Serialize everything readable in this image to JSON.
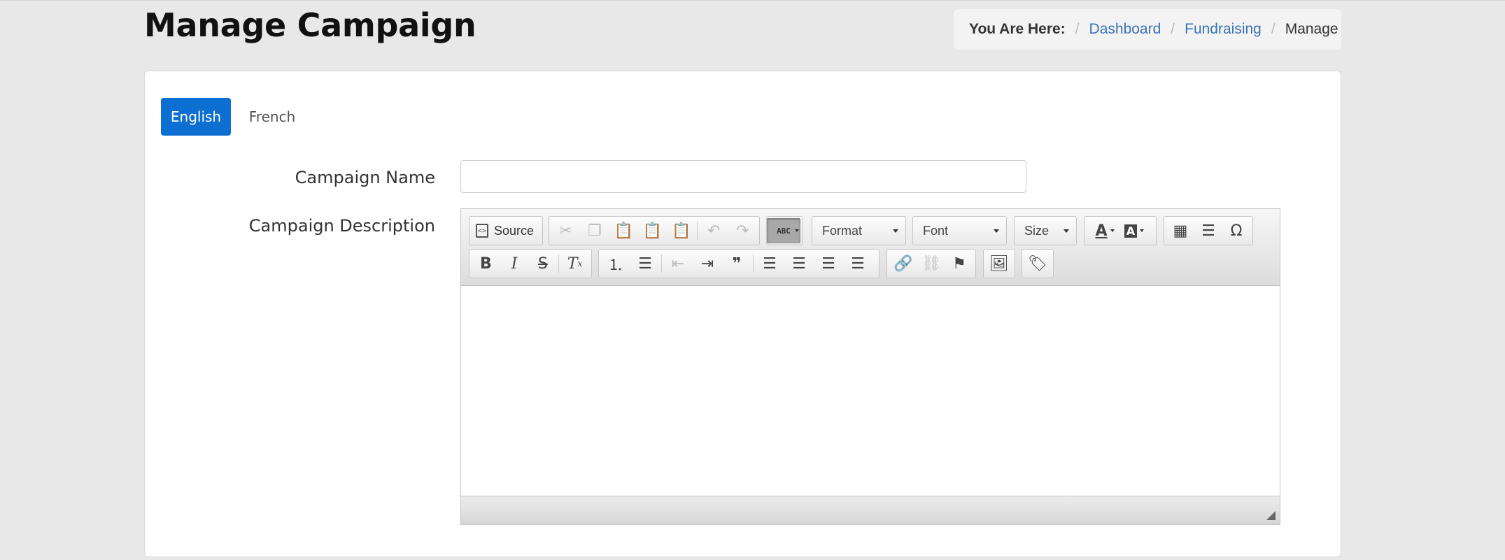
{
  "page": {
    "title": "Manage Campaign"
  },
  "breadcrumb": {
    "label": "You Are Here:",
    "items": [
      {
        "text": "Dashboard"
      },
      {
        "text": "Fundraising"
      },
      {
        "text": "Manage"
      }
    ]
  },
  "tabs": [
    {
      "label": "English",
      "active": true
    },
    {
      "label": "French",
      "active": false
    }
  ],
  "form": {
    "campaign_name_label": "Campaign Name",
    "campaign_name_value": "",
    "campaign_description_label": "Campaign Description"
  },
  "editor": {
    "source_label": "Source",
    "format_label": "Format",
    "font_label": "Font",
    "size_label": "Size",
    "spellcheck_label": "ABC",
    "content": ""
  },
  "colors": {
    "accent": "#0d6fd1",
    "link": "#3a73b3",
    "background": "#e8e8e8"
  }
}
